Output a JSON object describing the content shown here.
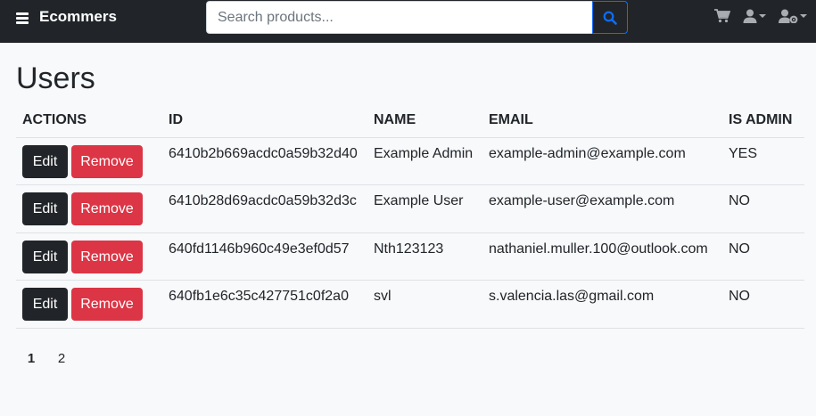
{
  "navbar": {
    "brand": "Ecommers",
    "search_placeholder": "Search products...",
    "icons": [
      "menu-icon",
      "search-icon",
      "cart-icon",
      "user-icon",
      "admin-icon"
    ]
  },
  "page": {
    "title": "Users"
  },
  "table": {
    "headers": {
      "actions": "ACTIONS",
      "id": "ID",
      "name": "NAME",
      "email": "EMAIL",
      "is_admin": "IS ADMIN"
    },
    "rows": [
      {
        "edit_label": "Edit",
        "remove_label": "Remove",
        "id": "6410b2b669acdc0a59b32d40",
        "name": "Example Admin",
        "email": "example-admin@example.com",
        "is_admin": "YES"
      },
      {
        "edit_label": "Edit",
        "remove_label": "Remove",
        "id": "6410b28d69acdc0a59b32d3c",
        "name": "Example User",
        "email": "example-user@example.com",
        "is_admin": "NO"
      },
      {
        "edit_label": "Edit",
        "remove_label": "Remove",
        "id": "640fd1146b960c49e3ef0d57",
        "name": "Nth123123",
        "email": "nathaniel.muller.100@outlook.com",
        "is_admin": "NO"
      },
      {
        "edit_label": "Edit",
        "remove_label": "Remove",
        "id": "640fb1e6c35c427751c0f2a0",
        "name": "svl",
        "email": "s.valencia.las@gmail.com",
        "is_admin": "NO"
      }
    ]
  },
  "pagination": {
    "pages": [
      "1",
      "2"
    ],
    "active": "1"
  },
  "colors": {
    "navbar_bg": "#212529",
    "edit_button": "#212529",
    "remove_button": "#dc3545",
    "search_button_border": "#0d6efd",
    "search_icon": "#0d6efd"
  }
}
